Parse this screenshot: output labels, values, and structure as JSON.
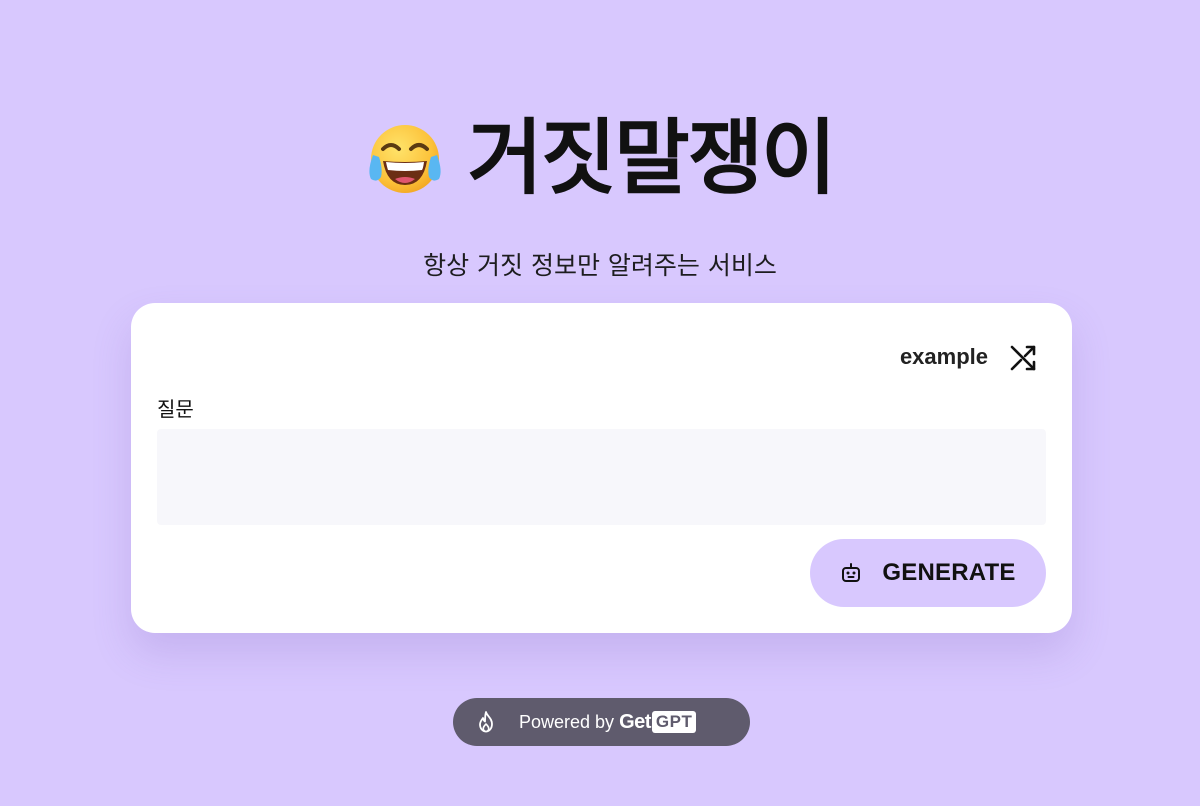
{
  "header": {
    "emoji_icon": "face-with-tears-of-joy-icon",
    "title": "거짓말쟁이",
    "subtitle": "항상 거짓 정보만 알려주는 서비스"
  },
  "form": {
    "example_label": "example",
    "example_icon": "shuffle-icon",
    "question_label": "질문",
    "question_value": "",
    "question_placeholder": "",
    "generate_label": "GENERATE",
    "generate_icon": "robot-icon"
  },
  "footer": {
    "powered_by_label": "Powered by",
    "brand_get": "Get",
    "brand_gpt": "GPT",
    "icon": "flame-icon"
  },
  "colors": {
    "background": "#d8c8fe",
    "card": "#ffffff",
    "input_bg": "#f7f7fb",
    "button_bg": "#d8c8fe",
    "footer_pill": "#5f5b6d"
  }
}
